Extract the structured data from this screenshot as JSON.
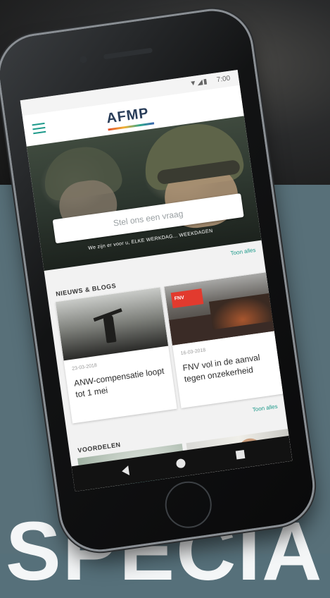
{
  "status_bar": {
    "icons": "▼◢▮",
    "time": "7:00"
  },
  "app": {
    "logo_text": "AFMP",
    "brand_colors": [
      "#e24e2a",
      "#f2b033",
      "#2ca58d",
      "#3c65b0"
    ],
    "accent_color": "#1e9a8b"
  },
  "hero": {
    "search_placeholder": "Stel ons een vraag",
    "caption": "We zijn er voor u, ELKE WERKDAG... WEEKDAGEN"
  },
  "news": {
    "section_title": "NIEUWS & BLOGS",
    "see_all": "Toon alles",
    "cards": [
      {
        "date": "23-03-2018",
        "title": "ANW-compensatie loopt tot 1 mei"
      },
      {
        "date": "16-03-2018",
        "title": "FNV vol in de aanval tegen onzekerheid",
        "image_banner": "FNV"
      }
    ]
  },
  "benefits": {
    "section_title": "VOORDELEN",
    "see_all": "Toon alles"
  },
  "nav_bar": {
    "icons": [
      "back-icon",
      "home-icon",
      "recent-apps-icon"
    ]
  },
  "background": {
    "large_text": "SPECIA"
  }
}
